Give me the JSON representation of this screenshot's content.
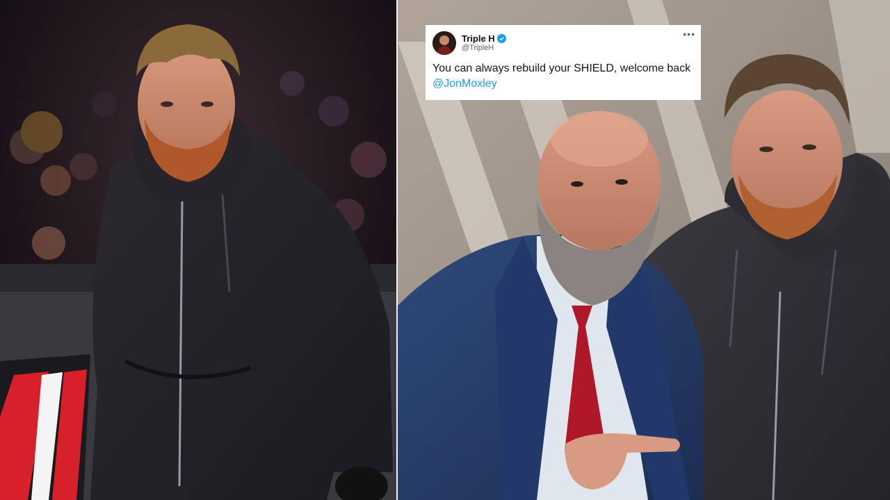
{
  "tweet": {
    "display_name": "Triple H",
    "handle": "@TripleH",
    "verified_icon": "verified-badge-icon",
    "more_icon": "more-options-icon",
    "more_glyph": "•••",
    "text": "You can always rebuild your SHIELD, welcome back",
    "mention": "@JonMoxley",
    "colors": {
      "mention": "#1d9bf0",
      "verified": "#1d9bf0",
      "text": "#0f1419",
      "handle": "#536471"
    }
  },
  "photos": {
    "left": {
      "subject": "wrestler-in-dark-hoodie-at-ringside"
    },
    "right": {
      "subject": "bearded-man-in-suit-pointing-beside-man-in-hoodie"
    }
  }
}
